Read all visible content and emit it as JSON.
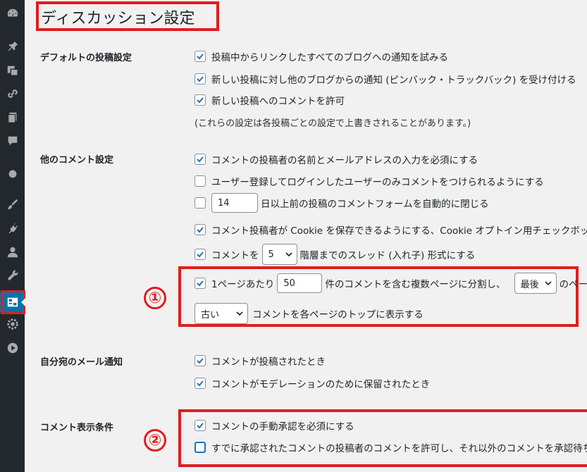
{
  "page": {
    "title": "ディスカッション設定"
  },
  "sidebar": {
    "items": [
      {
        "icon": "dashboard-icon"
      },
      {
        "icon": "pin-icon"
      },
      {
        "icon": "media-icon"
      },
      {
        "icon": "link-icon"
      },
      {
        "icon": "pages-icon"
      },
      {
        "icon": "comments-icon"
      },
      {
        "icon": "circle-icon"
      },
      {
        "icon": "brush-icon"
      },
      {
        "icon": "plugin-icon"
      },
      {
        "icon": "user-icon"
      },
      {
        "icon": "wrench-icon"
      },
      {
        "icon": "settings-active-icon"
      },
      {
        "icon": "gear-icon"
      },
      {
        "icon": "play-icon"
      }
    ]
  },
  "sections": {
    "default_post": {
      "label": "デフォルトの投稿設定",
      "opt1": "投稿中からリンクしたすべてのブログへの通知を試みる",
      "opt2": "新しい投稿に対し他のブログからの通知 (ピンバック・トラックバック) を受け付ける",
      "opt3": "新しい投稿へのコメントを許可",
      "note": "(これらの設定は各投稿ごとの設定で上書きされることがあります。)"
    },
    "other_comment": {
      "label": "他のコメント設定",
      "opt1": "コメントの投稿者の名前とメールアドレスの入力を必須にする",
      "opt2": "ユーザー登録してログインしたユーザーのみコメントをつけられるようにする",
      "days_value": "14",
      "opt3_suffix": "日以上前の投稿のコメントフォームを自動的に閉じる",
      "opt4": "コメント投稿者が Cookie を保存できるようにする、Cookie オプトイン用チェックボックスを表示します。",
      "opt5_prefix": "コメントを",
      "thread_depth": "5",
      "opt5_suffix": "階層までのスレッド (入れ子) 形式にする",
      "opt6_prefix": "1ページあたり",
      "per_page": "50",
      "opt6_mid": "件のコメントを含む複数ページに分割し、",
      "page_select": "最後",
      "opt6_suffix": "のページを",
      "order_select": "古い",
      "opt7_suffix": "コメントを各ページのトップに表示する"
    },
    "email": {
      "label": "自分宛のメール通知",
      "opt1": "コメントが投稿されたとき",
      "opt2": "コメントがモデレーションのために保留されたとき"
    },
    "appear": {
      "label": "コメント表示条件",
      "opt1": "コメントの手動承認を必須にする",
      "opt2": "すでに承認されたコメントの投稿者のコメントを許可し、それ以外のコメントを承認待ちにする"
    }
  },
  "annotations": {
    "one": "①",
    "two": "②"
  },
  "colors": {
    "accent": "#2271b1",
    "highlight": "#e01e1e",
    "sidebar": "#23282d",
    "active": "#0073aa"
  }
}
